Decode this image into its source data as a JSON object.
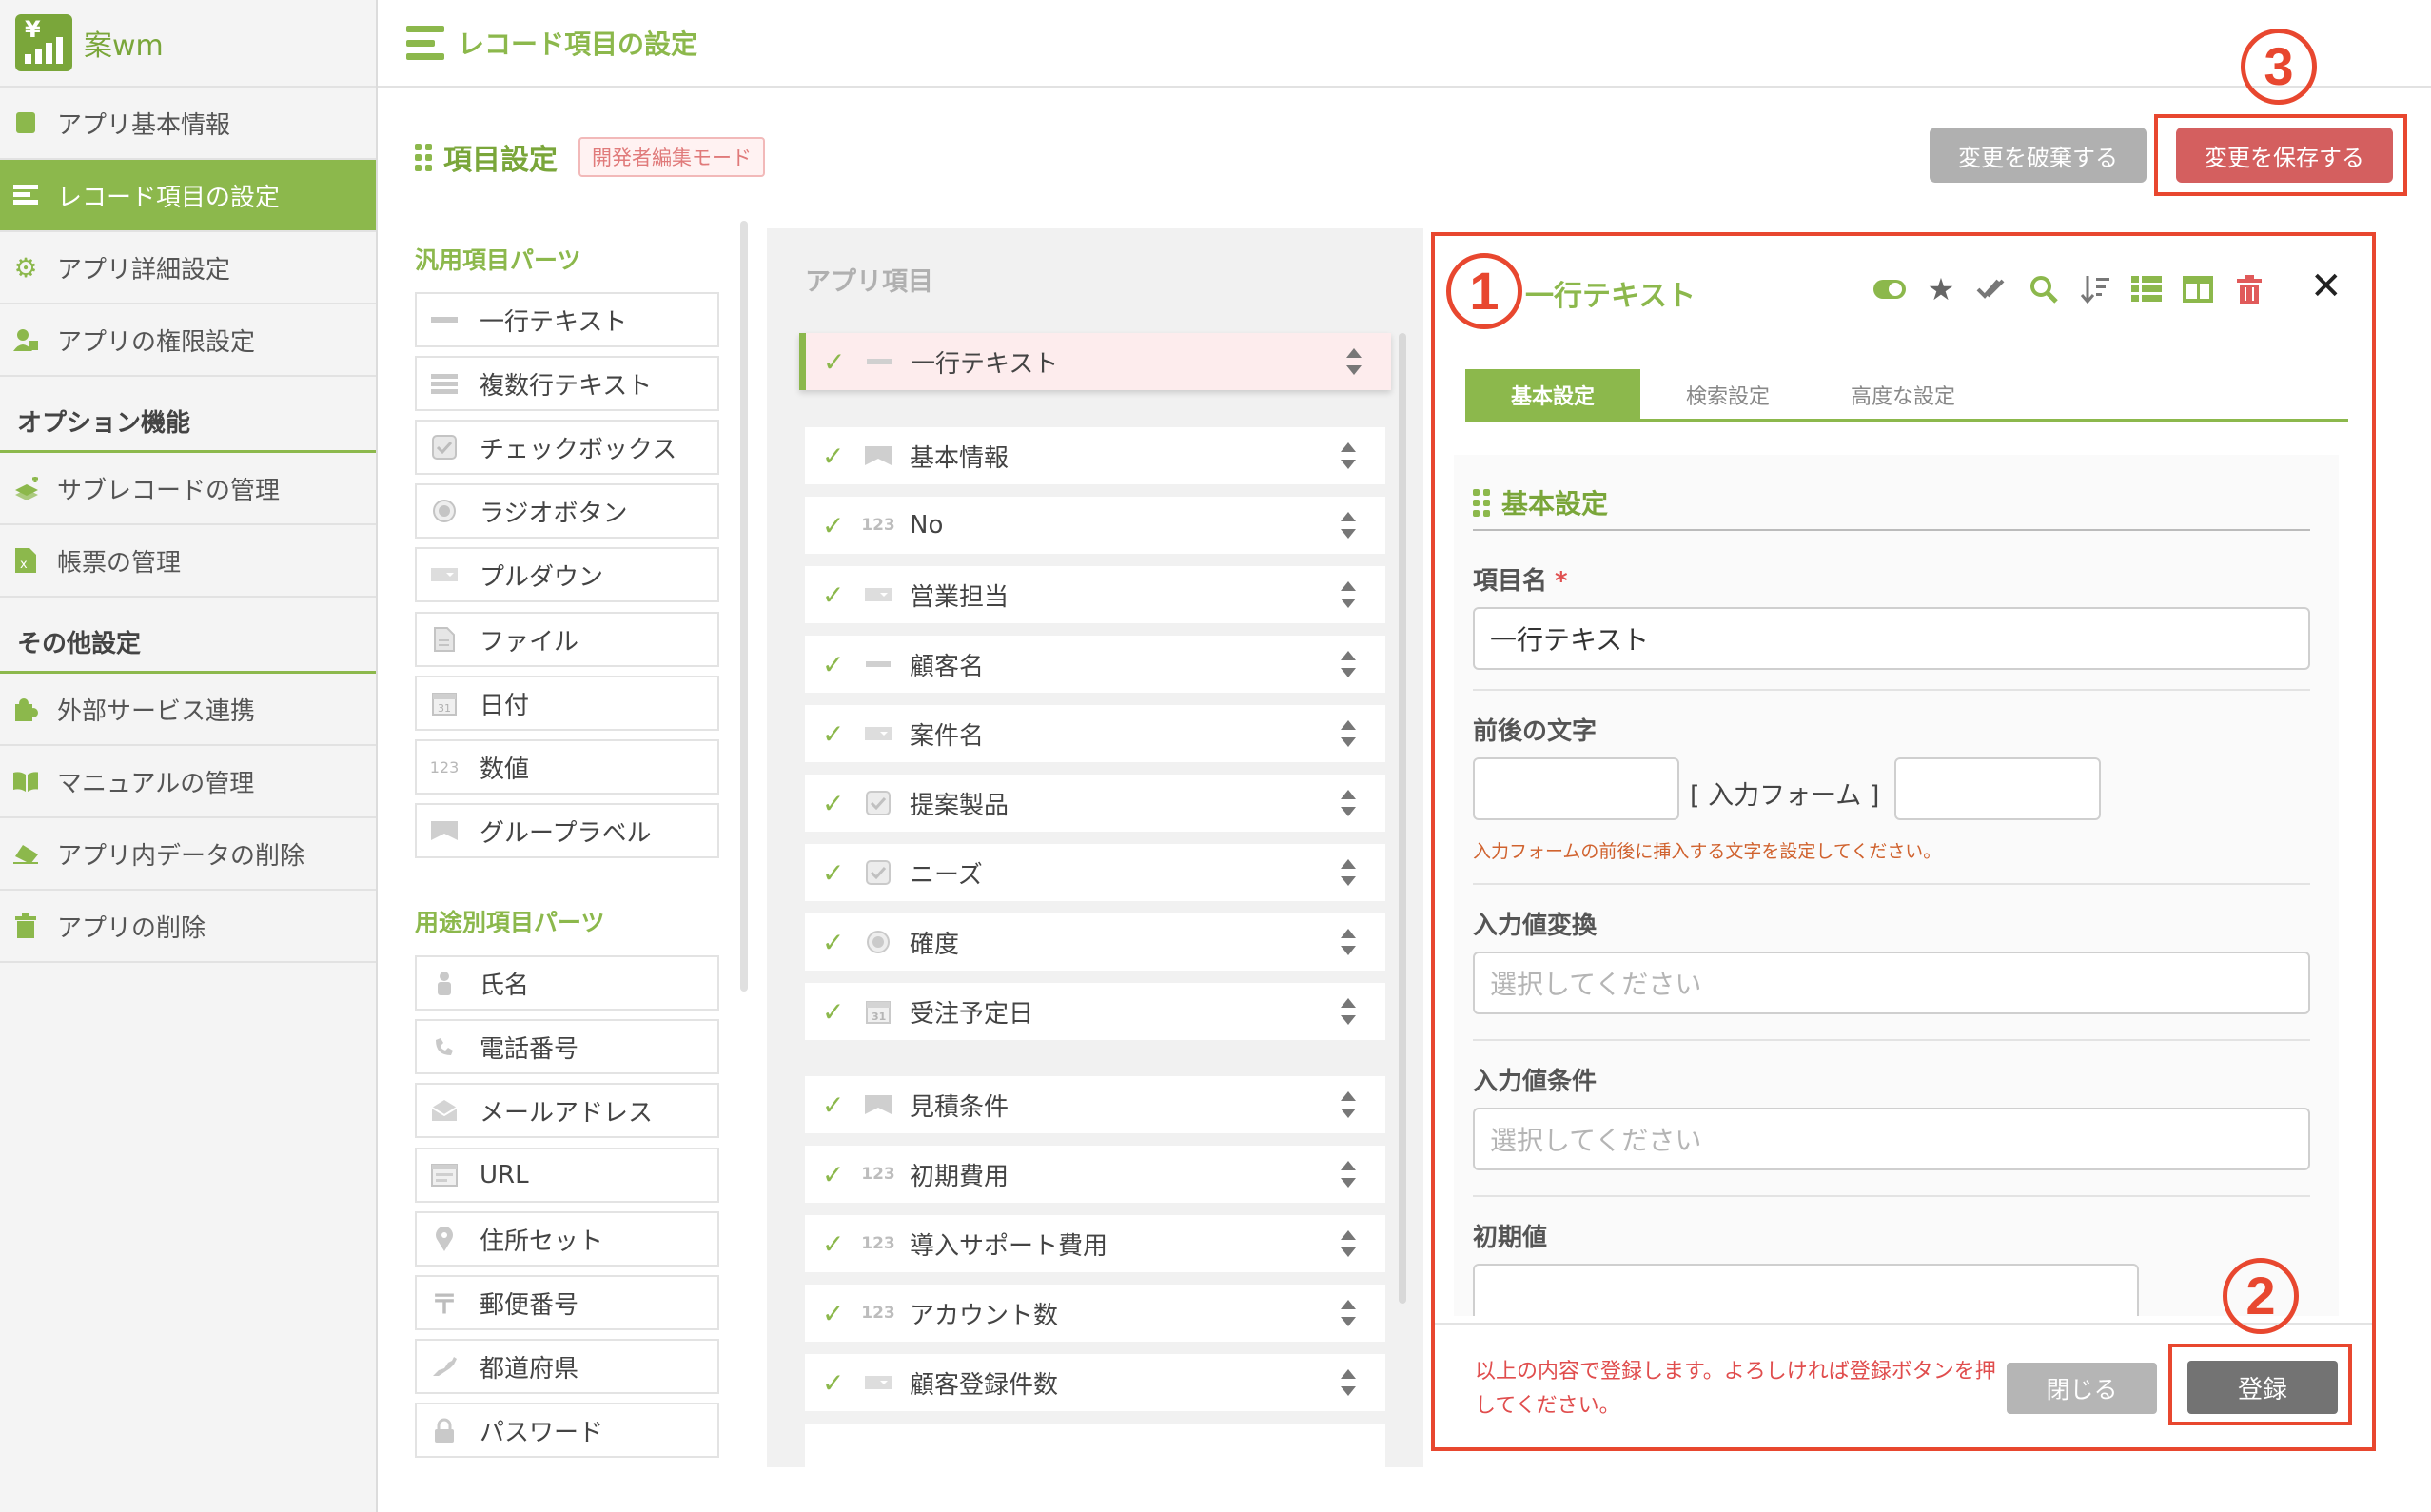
{
  "app": {
    "name": "案wm",
    "logo_icon": "app-logo-icon"
  },
  "header": {
    "title": "レコード項目の設定"
  },
  "sidebar": {
    "items": [
      {
        "label": "アプリ基本情報",
        "icon": "info-icon"
      },
      {
        "label": "レコード項目の設定",
        "icon": "list-icon",
        "active": true
      },
      {
        "label": "アプリ詳細設定",
        "icon": "gear-icon"
      },
      {
        "label": "アプリの権限設定",
        "icon": "user-lock-icon"
      }
    ],
    "option_heading": "オプション機能",
    "option_items": [
      {
        "label": "サブレコードの管理",
        "icon": "layers-icon"
      },
      {
        "label": "帳票の管理",
        "icon": "excel-file-icon"
      }
    ],
    "other_heading": "その他設定",
    "other_items": [
      {
        "label": "外部サービス連携",
        "icon": "puzzle-icon"
      },
      {
        "label": "マニュアルの管理",
        "icon": "book-icon"
      },
      {
        "label": "アプリ内データの削除",
        "icon": "eraser-icon"
      },
      {
        "label": "アプリの削除",
        "icon": "trash-icon"
      }
    ]
  },
  "section": {
    "title": "項目設定",
    "dev_mode_badge": "開発者編集モード",
    "discard_label": "変更を破棄する",
    "save_label": "変更を保存する"
  },
  "palette": {
    "general_heading": "汎用項目パーツ",
    "general_items": [
      {
        "label": "一行テキスト",
        "icon": "single-line-icon"
      },
      {
        "label": "複数行テキスト",
        "icon": "multi-line-icon"
      },
      {
        "label": "チェックボックス",
        "icon": "checkbox-icon"
      },
      {
        "label": "ラジオボタン",
        "icon": "radio-icon"
      },
      {
        "label": "プルダウン",
        "icon": "dropdown-icon"
      },
      {
        "label": "ファイル",
        "icon": "file-icon"
      },
      {
        "label": "日付",
        "icon": "calendar-icon"
      },
      {
        "label": "数値",
        "icon": "number-icon",
        "glyph": "123"
      },
      {
        "label": "グループラベル",
        "icon": "group-label-icon"
      }
    ],
    "purpose_heading": "用途別項目パーツ",
    "purpose_items": [
      {
        "label": "氏名",
        "icon": "person-icon"
      },
      {
        "label": "電話番号",
        "icon": "phone-icon"
      },
      {
        "label": "メールアドレス",
        "icon": "mail-icon"
      },
      {
        "label": "URL",
        "icon": "url-icon"
      },
      {
        "label": "住所セット",
        "icon": "map-pin-icon"
      },
      {
        "label": "郵便番号",
        "icon": "postal-icon",
        "glyph": "〒"
      },
      {
        "label": "都道府県",
        "icon": "japan-map-icon"
      },
      {
        "label": "パスワード",
        "icon": "lock-icon"
      }
    ]
  },
  "app_items": {
    "heading": "アプリ項目",
    "selected": {
      "label": "一行テキスト",
      "icon": "single-line-icon"
    },
    "group1": [
      {
        "label": "基本情報",
        "icon": "group-label-icon"
      },
      {
        "label": "No",
        "icon": "number-icon",
        "glyph": "123"
      },
      {
        "label": "営業担当",
        "icon": "dropdown-icon"
      },
      {
        "label": "顧客名",
        "icon": "single-line-icon"
      },
      {
        "label": "案件名",
        "icon": "dropdown-icon"
      },
      {
        "label": "提案製品",
        "icon": "checkbox-icon"
      },
      {
        "label": "ニーズ",
        "icon": "checkbox-icon"
      },
      {
        "label": "確度",
        "icon": "radio-icon"
      },
      {
        "label": "受注予定日",
        "icon": "calendar-icon"
      }
    ],
    "group2": [
      {
        "label": "見積条件",
        "icon": "group-label-icon"
      },
      {
        "label": "初期費用",
        "icon": "number-icon",
        "glyph": "123"
      },
      {
        "label": "導入サポート費用",
        "icon": "number-icon",
        "glyph": "123"
      },
      {
        "label": "アカウント数",
        "icon": "number-icon",
        "glyph": "123"
      },
      {
        "label": "顧客登録件数",
        "icon": "dropdown-icon"
      }
    ]
  },
  "panel": {
    "title": "一行テキスト",
    "tools": [
      "toggle-icon",
      "star-icon",
      "double-check-icon",
      "search-icon",
      "sort-icon",
      "table-icon",
      "columns-icon",
      "trash-icon"
    ],
    "tabs": [
      "基本設定",
      "検索設定",
      "高度な設定"
    ],
    "section_heading": "基本設定",
    "field_name_label": "項目名",
    "required_mark": "*",
    "field_name_value": "一行テキスト",
    "affix_label": "前後の文字",
    "affix_middle": "[ 入力フォーム ]",
    "affix_hint": "入力フォームの前後に挿入する文字を設定してください。",
    "conversion_label": "入力値変換",
    "conversion_placeholder": "選択してください",
    "condition_label": "入力値条件",
    "condition_placeholder": "選択してください",
    "default_label": "初期値",
    "footer_message": "以上の内容で登録します。よろしければ登録ボタンを押してください。",
    "close_label": "閉じる",
    "register_label": "登録"
  },
  "annotations": {
    "one": "1",
    "two": "2",
    "three": "3"
  },
  "colors": {
    "brand_green": "#8cb84c",
    "annotation_red": "#e8472f",
    "save_red": "#d45f5f"
  }
}
